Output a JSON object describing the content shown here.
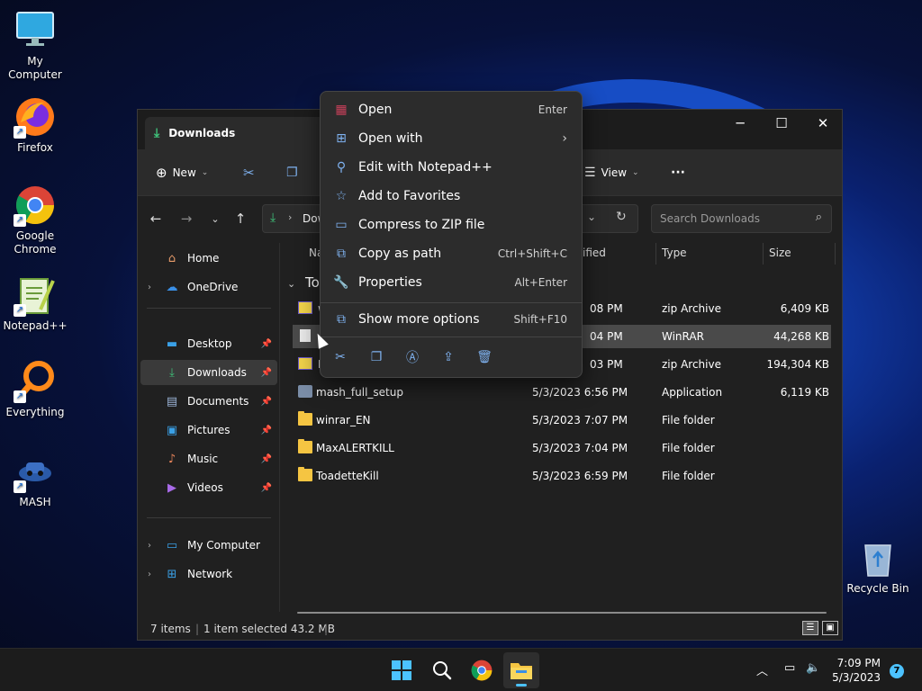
{
  "desktop": {
    "icons": [
      {
        "label": "My Computer",
        "icon": "monitor-icon"
      },
      {
        "label": "Firefox",
        "icon": "firefox-icon"
      },
      {
        "label": "Google Chrome",
        "icon": "chrome-icon"
      },
      {
        "label": "Notepad++",
        "icon": "notepadpp-icon"
      },
      {
        "label": "Everything",
        "icon": "everything-icon"
      },
      {
        "label": "MASH",
        "icon": "mash-icon"
      },
      {
        "label": "Recycle Bin",
        "icon": "recycle-bin-icon"
      }
    ]
  },
  "window": {
    "tab_title": "Downloads",
    "controls": {
      "minimize": "─",
      "maximize": "☐",
      "close": "✕"
    }
  },
  "commandbar": {
    "new_label": "New",
    "view_label": "View",
    "more_label": "···"
  },
  "address": {
    "path_label": "Downloads",
    "search_placeholder": "Search Downloads"
  },
  "navpane": {
    "items": [
      {
        "label": "Home",
        "icon": "home-icon"
      },
      {
        "label": "OneDrive",
        "icon": "cloud-icon"
      },
      {
        "label": "Desktop",
        "icon": "desktop-icon"
      },
      {
        "label": "Downloads",
        "icon": "download-icon"
      },
      {
        "label": "Documents",
        "icon": "documents-icon"
      },
      {
        "label": "Pictures",
        "icon": "pictures-icon"
      },
      {
        "label": "Music",
        "icon": "music-icon"
      },
      {
        "label": "Videos",
        "icon": "videos-icon"
      },
      {
        "label": "My Computer",
        "icon": "computer-icon"
      },
      {
        "label": "Network",
        "icon": "network-icon"
      }
    ]
  },
  "filelist": {
    "columns": {
      "name": "Na",
      "modified": "ified",
      "type": "Type",
      "size": "Size"
    },
    "group_label": "Tod",
    "rows": [
      {
        "name": "w",
        "modified": "08 PM",
        "type": "zip Archive",
        "size": "6,409 KB"
      },
      {
        "name": "",
        "modified": "04 PM",
        "type": "WinRAR",
        "size": "44,268 KB"
      },
      {
        "name": "N",
        "modified": "03 PM",
        "type": "zip Archive",
        "size": "194,304 KB"
      },
      {
        "name": "mash_full_setup",
        "modified": "5/3/2023 6:56 PM",
        "type": "Application",
        "size": "6,119 KB"
      },
      {
        "name": "winrar_EN",
        "modified": "5/3/2023 7:07 PM",
        "type": "File folder",
        "size": ""
      },
      {
        "name": "MaxALERTKILL",
        "modified": "5/3/2023 7:04 PM",
        "type": "File folder",
        "size": ""
      },
      {
        "name": "ToadetteKill",
        "modified": "5/3/2023 6:59 PM",
        "type": "File folder",
        "size": ""
      }
    ]
  },
  "statusbar": {
    "items_count": "7 items",
    "selection": "1 item selected  43.2 MB"
  },
  "context_menu": {
    "items": [
      {
        "label": "Open",
        "shortcut": "Enter",
        "icon": "winrar-icon"
      },
      {
        "label": "Open with",
        "shortcut": "",
        "icon": "open-with-icon"
      },
      {
        "label": "Edit with Notepad++",
        "shortcut": "",
        "icon": "notepadpp-icon"
      },
      {
        "label": "Add to Favorites",
        "shortcut": "",
        "icon": "star-icon"
      },
      {
        "label": "Compress to ZIP file",
        "shortcut": "",
        "icon": "zip-icon"
      },
      {
        "label": "Copy as path",
        "shortcut": "Ctrl+Shift+C",
        "icon": "copy-path-icon"
      },
      {
        "label": "Properties",
        "shortcut": "Alt+Enter",
        "icon": "wrench-icon"
      },
      {
        "label": "Show more options",
        "shortcut": "Shift+F10",
        "icon": "more-options-icon"
      }
    ]
  },
  "taskbar": {
    "time": "7:09 PM",
    "date": "5/3/2023",
    "notifications": "7"
  }
}
